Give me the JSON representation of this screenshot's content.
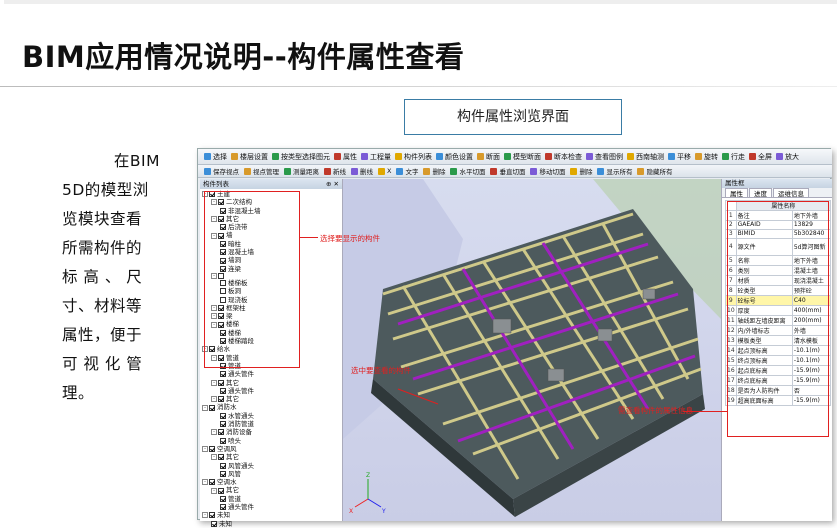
{
  "slide": {
    "title": "BIM应用情况说明--构件属性查看",
    "callout": "构件属性浏览界面",
    "description_lines": [
      "在BIM",
      "5D的模型浏",
      "览模块查看",
      "所需构件的",
      "标 高 、 尺",
      "寸、材料等",
      "属性，便于",
      "可 视 化 管",
      "理。"
    ]
  },
  "toolbar1": {
    "items": [
      "选择",
      "楼层设置",
      "按类型选择图元",
      "属性",
      "工程量",
      "构件列表",
      "颜色设置",
      "断面",
      "模型断面",
      "断本检查",
      "查看图例",
      "西南轴测",
      "平移",
      "旋转",
      "行走",
      "全屏",
      "放大"
    ]
  },
  "toolbar2": {
    "items": [
      "保存视点",
      "视点管理",
      "测量距离",
      "新线",
      "删线",
      "X",
      "文字",
      "删除",
      "水平切面",
      "垂直切面",
      "移动切面",
      "删除",
      "显示所有",
      "隐藏所有"
    ]
  },
  "left_panel": {
    "title": "构件列表",
    "controls": "⊕ ✕",
    "tree": [
      {
        "label": "土建",
        "level": 0,
        "exp": "-",
        "check": true
      },
      {
        "label": "二次结构",
        "level": 1,
        "exp": "-",
        "check": true
      },
      {
        "label": "非混凝土墙",
        "level": 2,
        "exp": "",
        "check": true
      },
      {
        "label": "其它",
        "level": 1,
        "exp": "-",
        "check": true
      },
      {
        "label": "后浇带",
        "level": 2,
        "exp": "",
        "check": true
      },
      {
        "label": "墙",
        "level": 1,
        "exp": "-",
        "check": true
      },
      {
        "label": "暗柱",
        "level": 2,
        "exp": "",
        "check": true
      },
      {
        "label": "混凝土墙",
        "level": 2,
        "exp": "",
        "check": true
      },
      {
        "label": "墙洞",
        "level": 2,
        "exp": "",
        "check": true
      },
      {
        "label": "连梁",
        "level": 2,
        "exp": "",
        "check": true
      },
      {
        "label": "",
        "level": 1,
        "exp": "-",
        "check": false
      },
      {
        "label": "楼梯板",
        "level": 2,
        "exp": "",
        "check": false
      },
      {
        "label": "板洞",
        "level": 2,
        "exp": "",
        "check": false
      },
      {
        "label": "现浇板",
        "level": 2,
        "exp": "",
        "check": false
      },
      {
        "label": "框架柱",
        "level": 1,
        "exp": "-",
        "check": true
      },
      {
        "label": "梁",
        "level": 1,
        "exp": "-",
        "check": true
      },
      {
        "label": "楼梯",
        "level": 1,
        "exp": "-",
        "check": true
      },
      {
        "label": "楼梯",
        "level": 2,
        "exp": "",
        "check": true
      },
      {
        "label": "楼梯踏段",
        "level": 2,
        "exp": "",
        "check": true
      },
      {
        "label": "给水",
        "level": 0,
        "exp": "-",
        "check": true
      },
      {
        "label": "管道",
        "level": 1,
        "exp": "-",
        "check": true
      },
      {
        "label": "管道",
        "level": 2,
        "exp": "",
        "check": true
      },
      {
        "label": "通头管件",
        "level": 2,
        "exp": "",
        "check": true
      },
      {
        "label": "其它",
        "level": 1,
        "exp": "-",
        "check": true
      },
      {
        "label": "通头管件",
        "level": 2,
        "exp": "",
        "check": true
      },
      {
        "label": "其它",
        "level": 1,
        "exp": "-",
        "check": true
      },
      {
        "label": "消防水",
        "level": 0,
        "exp": "-",
        "check": true
      },
      {
        "label": "水管通头",
        "level": 2,
        "exp": "",
        "check": true
      },
      {
        "label": "消防管道",
        "level": 2,
        "exp": "",
        "check": true
      },
      {
        "label": "消防设备",
        "level": 1,
        "exp": "-",
        "check": true
      },
      {
        "label": "喷头",
        "level": 2,
        "exp": "",
        "check": true
      },
      {
        "label": "空调风",
        "level": 0,
        "exp": "-",
        "check": true
      },
      {
        "label": "其它",
        "level": 1,
        "exp": "-",
        "check": true
      },
      {
        "label": "风管通头",
        "level": 2,
        "exp": "",
        "check": true
      },
      {
        "label": "风管",
        "level": 2,
        "exp": "",
        "check": true
      },
      {
        "label": "空调水",
        "level": 0,
        "exp": "-",
        "check": true
      },
      {
        "label": "其它",
        "level": 1,
        "exp": "-",
        "check": true
      },
      {
        "label": "管道",
        "level": 2,
        "exp": "",
        "check": true
      },
      {
        "label": "通头管件",
        "level": 2,
        "exp": "",
        "check": true
      },
      {
        "label": "未知",
        "level": 0,
        "exp": "-",
        "check": true
      },
      {
        "label": "未知",
        "level": 1,
        "exp": "",
        "check": true
      },
      {
        "label": "楼梯踏",
        "level": 0,
        "exp": "-",
        "check": true
      }
    ]
  },
  "annotations": {
    "select_components": "选择要显示的构件",
    "selected_component": "选中要查看的构件",
    "view_properties": "需查看构件的属性信息"
  },
  "right_panel": {
    "title": "属性框",
    "tabs": [
      "属性",
      "进度",
      "运维信息"
    ],
    "header": "属性名称",
    "rows": [
      [
        "1",
        "备注",
        "地下外墙"
      ],
      [
        "2",
        "GAEAID",
        "13829"
      ],
      [
        "3",
        "BIMID",
        "5b302840"
      ],
      [
        "4",
        "源文件",
        "5d算河图新"
      ],
      [
        "5",
        "名称",
        "地下外墙"
      ],
      [
        "6",
        "类别",
        "混凝土墙"
      ],
      [
        "7",
        "材质",
        "现浇混凝土"
      ],
      [
        "8",
        "砼类型",
        "预拌砼"
      ],
      [
        "9",
        "砼标号",
        "C40"
      ],
      [
        "10",
        "厚度",
        "400(mm)"
      ],
      [
        "11",
        "轴线距左墙皮距离",
        "200(mm)"
      ],
      [
        "12",
        "内/外墙标志",
        "外墙"
      ],
      [
        "13",
        "模板类型",
        "清水模板"
      ],
      [
        "14",
        "起点顶标高",
        "-10.1(m)"
      ],
      [
        "15",
        "终点顶标高",
        "-10.1(m)"
      ],
      [
        "16",
        "起点底标高",
        "-15.9(m)"
      ],
      [
        "17",
        "终点底标高",
        "-15.9(m)"
      ],
      [
        "18",
        "是否为人防构件",
        "否"
      ],
      [
        "19",
        "超高底面标高",
        "-15.9(m)"
      ]
    ],
    "highlight_row": 8
  },
  "viewport": {
    "axis_labels": [
      "Z",
      "X",
      "Y"
    ]
  },
  "colors": {
    "annotation": "#e02020",
    "callout_border": "#3a7ca5",
    "beam": "#cfc98a",
    "pipe": "#a020c0",
    "slab": "#4d5a5d"
  }
}
